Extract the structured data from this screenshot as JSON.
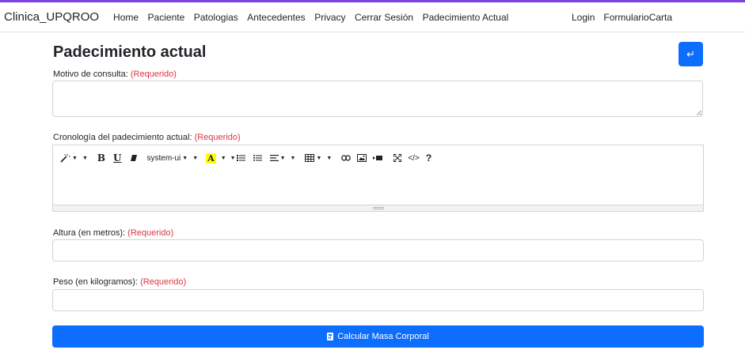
{
  "navbar": {
    "brand": "Clinica_UPQROO",
    "links": [
      "Home",
      "Paciente",
      "Patologias",
      "Antecedentes",
      "Privacy",
      "Cerrar Sesión",
      "Padecimiento Actual"
    ],
    "right_links": [
      "Login",
      "FormularioCarta"
    ]
  },
  "page": {
    "title": "Padecimiento actual",
    "back_icon": "↵"
  },
  "form": {
    "required_text": "(Requerido)",
    "motivo_label": "Motivo de consulta:",
    "motivo_value": "",
    "cronologia_label": "Cronología del padecimiento actual:",
    "altura_label": "Altura (en metros):",
    "altura_value": "",
    "peso_label": "Peso (en kilogramos):",
    "peso_value": ""
  },
  "editor": {
    "font_name": "system-ui",
    "highlight_letter": "A",
    "bold": "B",
    "underline": "U",
    "help": "?",
    "code": "</>"
  },
  "button": {
    "calc_label": "Calcular Masa Corporal",
    "calc_icon": "calculator-icon"
  },
  "colors": {
    "accent": "#0d6efd",
    "required": "#dc3545",
    "topbar": "#7b3fe4"
  }
}
